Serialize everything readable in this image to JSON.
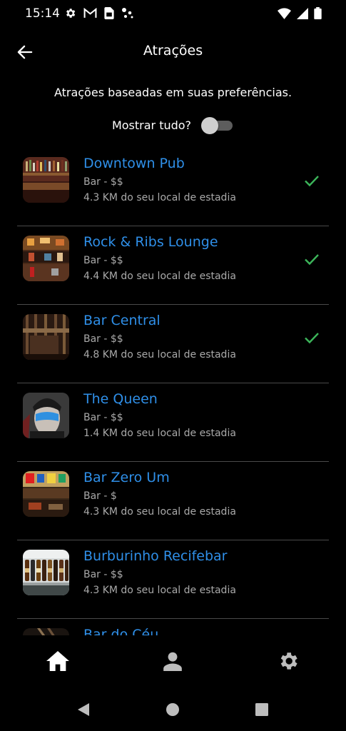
{
  "status_bar": {
    "time": "15:14",
    "left_icons": [
      "gear-icon",
      "gmail-icon",
      "sim-card-icon",
      "dots-icon"
    ],
    "right_icons": [
      "wifi-icon",
      "signal-icon",
      "battery-icon"
    ]
  },
  "header": {
    "title": "Atrações",
    "back_icon": "arrow-left-icon"
  },
  "subtitle": "Atrações baseadas em suas preferências.",
  "toggle": {
    "label": "Mostrar tudo?",
    "on": false
  },
  "colors": {
    "title_link": "#2f8fe8",
    "check": "#3cb55a",
    "secondary_text": "#a9a9a9",
    "divider": "#4a4a4a"
  },
  "attractions": [
    {
      "name": "Downtown Pub",
      "type": "Bar - $$",
      "distance": "4.3 KM do seu local de estadia",
      "checked": true
    },
    {
      "name": "Rock & Ribs Lounge",
      "type": "Bar - $$",
      "distance": "4.4 KM do seu local de estadia",
      "checked": true
    },
    {
      "name": "Bar Central",
      "type": "Bar - $$",
      "distance": "4.8 KM do seu local de estadia",
      "checked": true
    },
    {
      "name": "The Queen",
      "type": "Bar - $$",
      "distance": "1.4 KM do seu local de estadia",
      "checked": false
    },
    {
      "name": "Bar Zero Um",
      "type": "Bar - $",
      "distance": "4.3 KM do seu local de estadia",
      "checked": false
    },
    {
      "name": "Burburinho Recifebar",
      "type": "Bar - $$",
      "distance": "4.3 KM do seu local de estadia",
      "checked": false
    },
    {
      "name": "Bar do Céu",
      "type": "",
      "distance": "",
      "checked": false
    }
  ],
  "bottom_nav": {
    "items": [
      "home-icon",
      "profile-icon",
      "settings-icon"
    ],
    "active": "home-icon"
  },
  "system_nav": [
    "back-triangle-icon",
    "home-circle-icon",
    "recents-square-icon"
  ]
}
